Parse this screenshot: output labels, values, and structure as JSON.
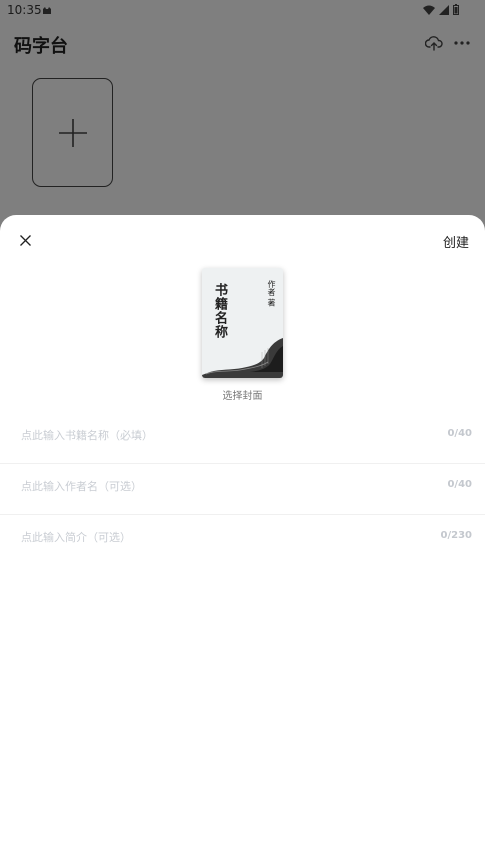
{
  "status_bar": {
    "time": "10:35"
  },
  "app_bar": {
    "title": "码字台"
  },
  "sheet": {
    "create_label": "创建",
    "cover": {
      "title": "书籍名称",
      "author": "作者 著",
      "caption": "选择封面"
    },
    "fields": [
      {
        "placeholder": "点此输入书籍名称（必填）",
        "value": "",
        "counter": "0/40"
      },
      {
        "placeholder": "点此输入作者名（可选）",
        "value": "",
        "counter": "0/40"
      },
      {
        "placeholder": "点此输入简介（可选）",
        "value": "",
        "counter": "0/230"
      }
    ]
  },
  "colors": {
    "scrim": "#7f7f7f",
    "sheet_bg": "#ffffff",
    "placeholder": "#c9cdd3"
  }
}
